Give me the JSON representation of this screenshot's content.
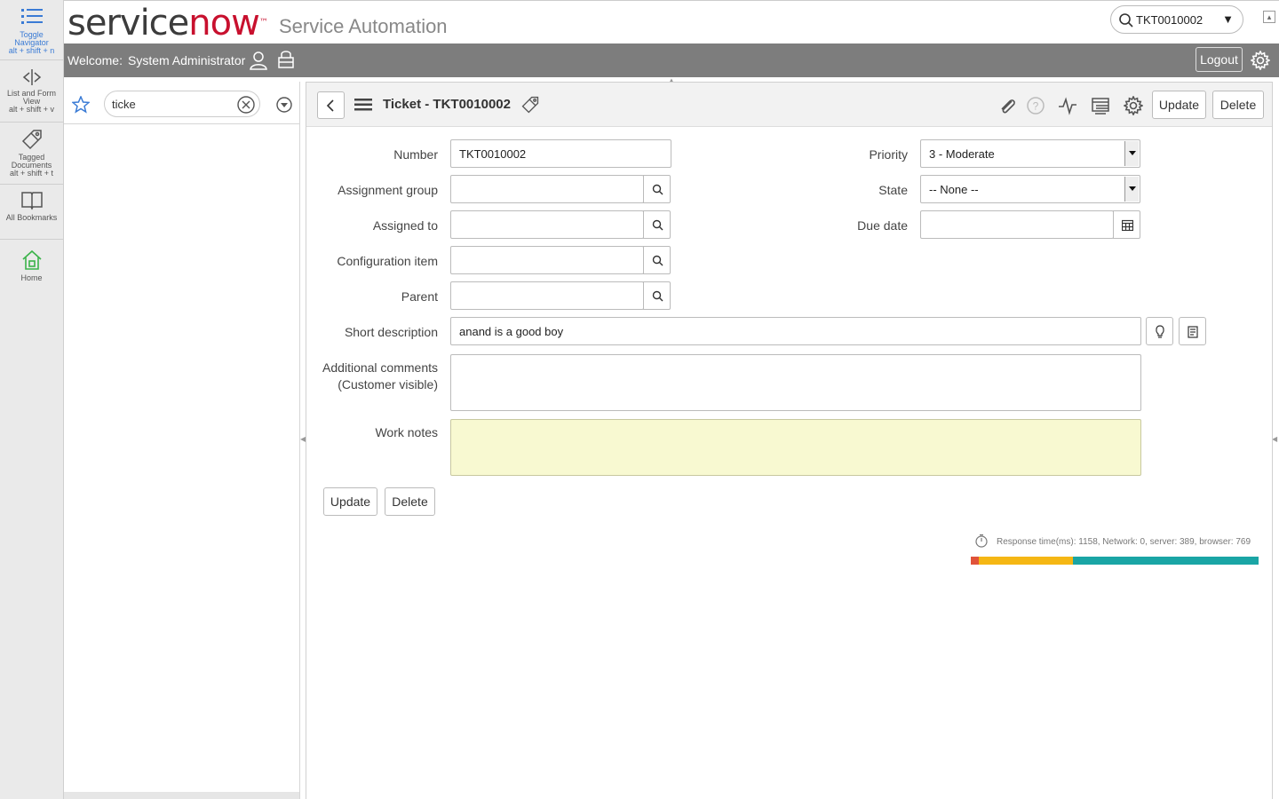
{
  "rail": {
    "toggle_navigator": {
      "line1": "Toggle",
      "line2": "Navigator",
      "shortcut": "alt + shift + n"
    },
    "list_form_view": {
      "line1": "List and Form",
      "line2": "View",
      "shortcut": "alt + shift + v"
    },
    "tagged_documents": {
      "line1": "Tagged",
      "line2": "Documents",
      "shortcut": "alt + shift + t"
    },
    "all_bookmarks": {
      "label": "All Bookmarks"
    },
    "home": {
      "label": "Home"
    }
  },
  "header": {
    "logo_service": "service",
    "logo_now": "now",
    "logo_tm": "™",
    "product": "Service Automation",
    "global_search_value": "TKT0010002"
  },
  "topbar": {
    "welcome": "Welcome:",
    "username": "System Administrator",
    "logout": "Logout"
  },
  "navigator": {
    "filter_value": "ticke"
  },
  "form": {
    "title": "Ticket - TKT0010002",
    "update_label": "Update",
    "delete_label": "Delete",
    "fields": {
      "number_label": "Number",
      "number_value": "TKT0010002",
      "assignment_group_label": "Assignment group",
      "assigned_to_label": "Assigned to",
      "configuration_item_label": "Configuration item",
      "parent_label": "Parent",
      "short_description_label": "Short description",
      "short_description_value": "anand is a good boy",
      "additional_comments_label_1": "Additional comments",
      "additional_comments_label_2": "(Customer visible)",
      "work_notes_label": "Work notes",
      "priority_label": "Priority",
      "priority_value": "3 - Moderate",
      "state_label": "State",
      "state_value": "-- None --",
      "due_date_label": "Due date"
    },
    "response_time": "Response time(ms): 1158, Network: 0, server: 389, browser: 769",
    "timing_breakdown_ms": {
      "total": 1158,
      "network": 0,
      "server": 389,
      "browser": 769
    },
    "timing_colors": {
      "network": "#e0533a",
      "server": "#f5b714",
      "browser": "#1aa5a5"
    }
  }
}
